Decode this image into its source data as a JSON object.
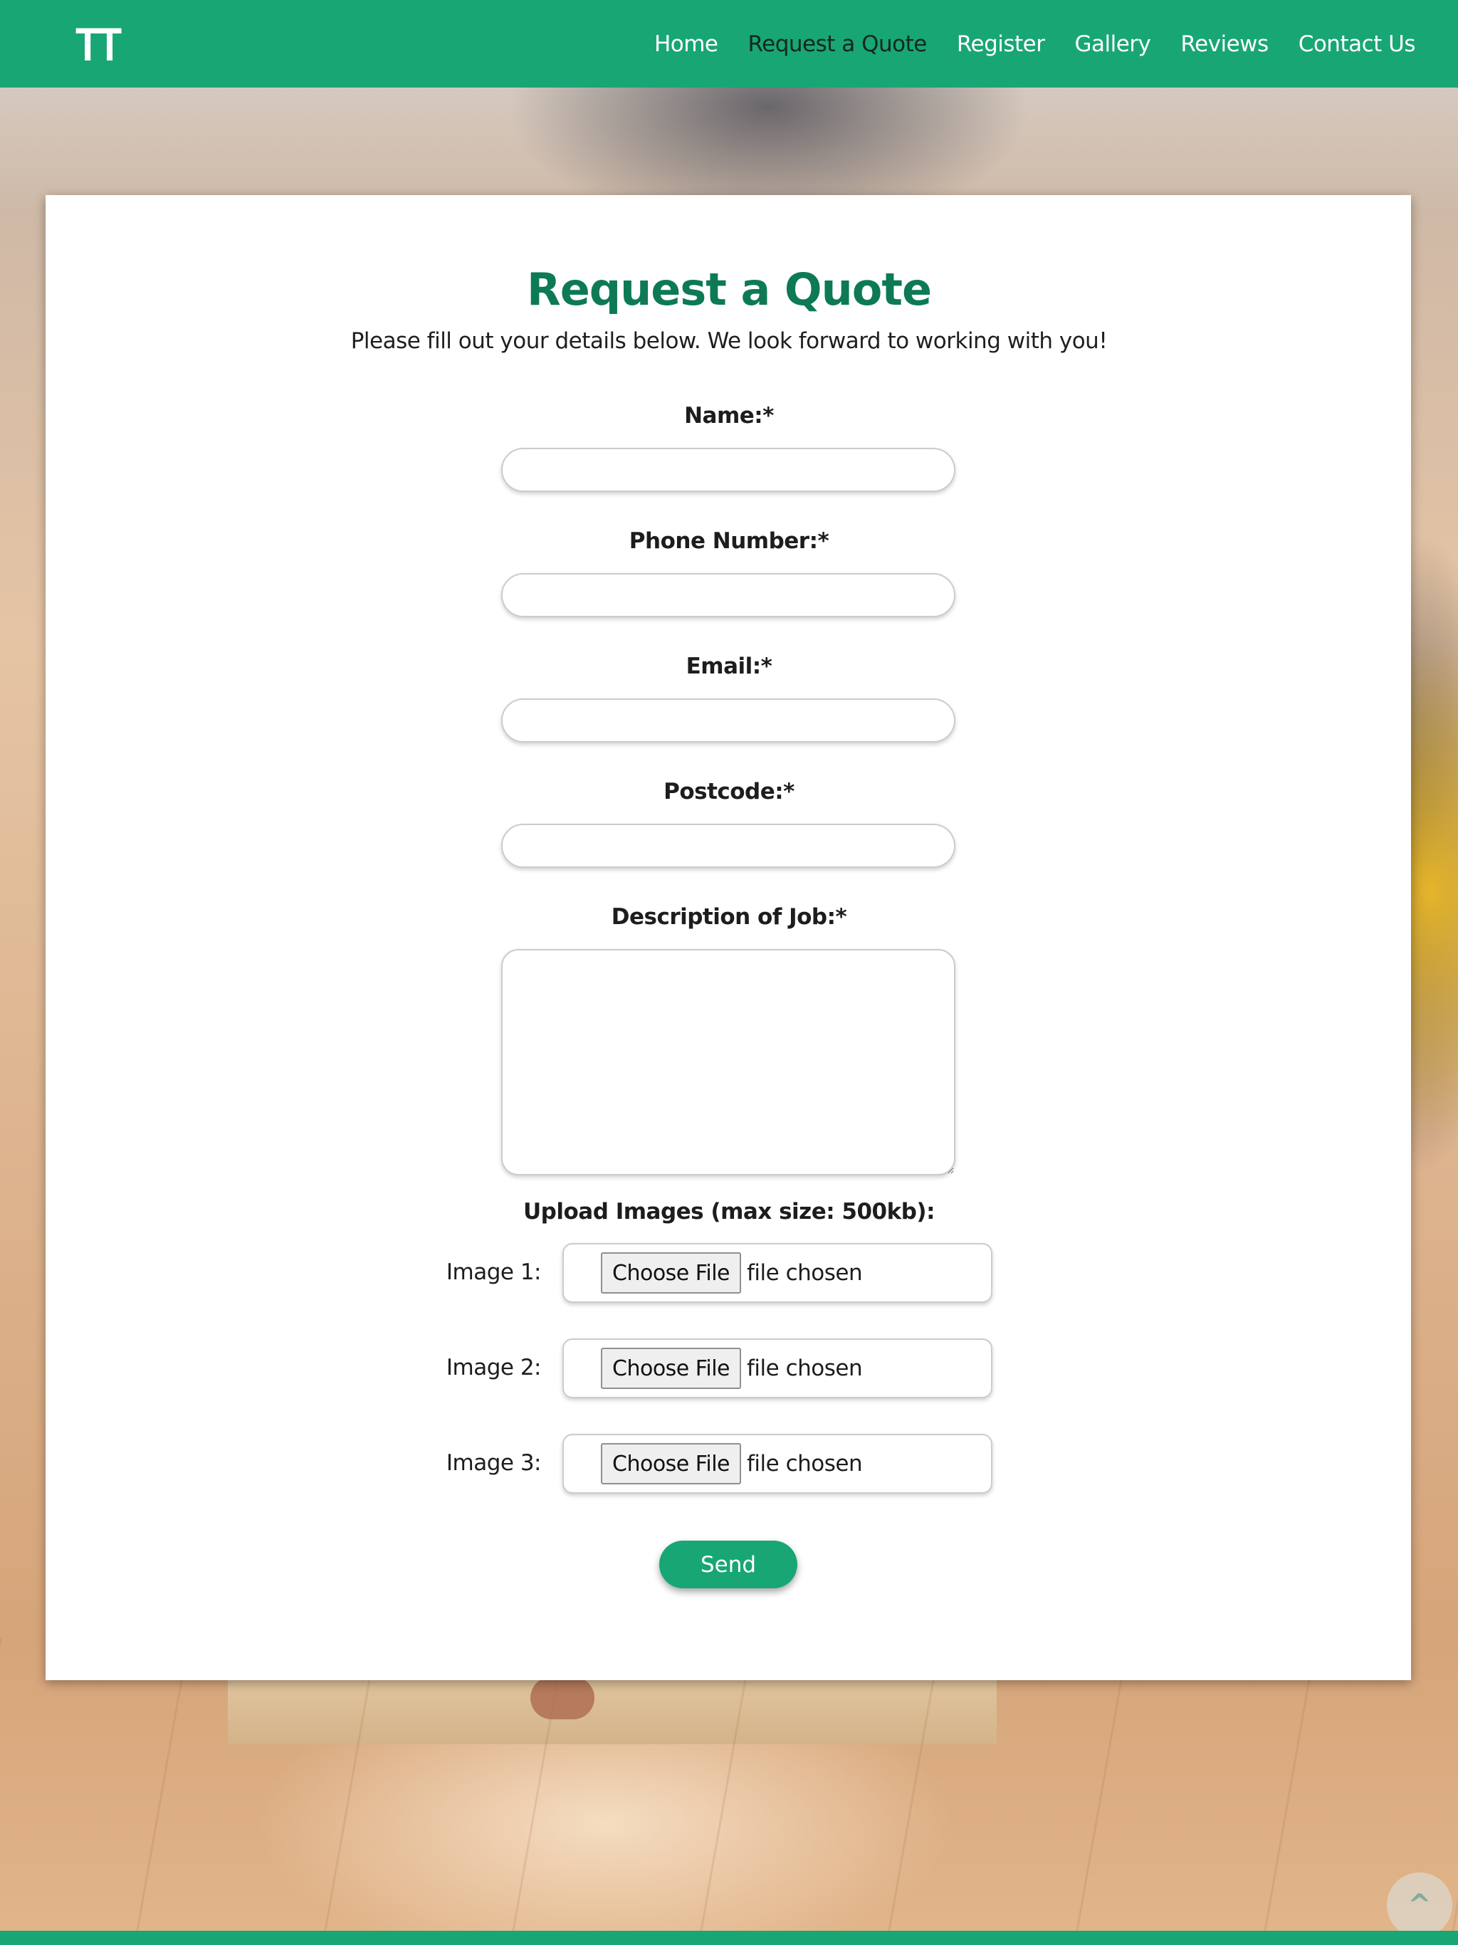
{
  "nav": {
    "logo": "TT",
    "links": [
      {
        "label": "Home",
        "active": false
      },
      {
        "label": "Request a Quote",
        "active": true
      },
      {
        "label": "Register",
        "active": false
      },
      {
        "label": "Gallery",
        "active": false
      },
      {
        "label": "Reviews",
        "active": false
      },
      {
        "label": "Contact Us",
        "active": false
      }
    ]
  },
  "form": {
    "title": "Request a Quote",
    "subtitle": "Please fill out your details below. We look forward to working with you!",
    "name_label": "Name:*",
    "phone_label": "Phone Number:*",
    "email_label": "Email:*",
    "postcode_label": "Postcode:*",
    "description_label": "Description of Job:*",
    "upload_label": "Upload Images (max size: 500kb):",
    "images": [
      {
        "label": "Image 1:",
        "button": "Choose File",
        "status": "file chosen"
      },
      {
        "label": "Image 2:",
        "button": "Choose File",
        "status": "file chosen"
      },
      {
        "label": "Image 3:",
        "button": "Choose File",
        "status": "file chosen"
      }
    ],
    "send_label": "Send"
  },
  "scroll_top": {
    "glyph": "^",
    "icon": "chevron-up-icon"
  },
  "colors": {
    "brand_green": "#18a675",
    "title_green": "#0d7a55",
    "active_nav": "#12281f"
  }
}
